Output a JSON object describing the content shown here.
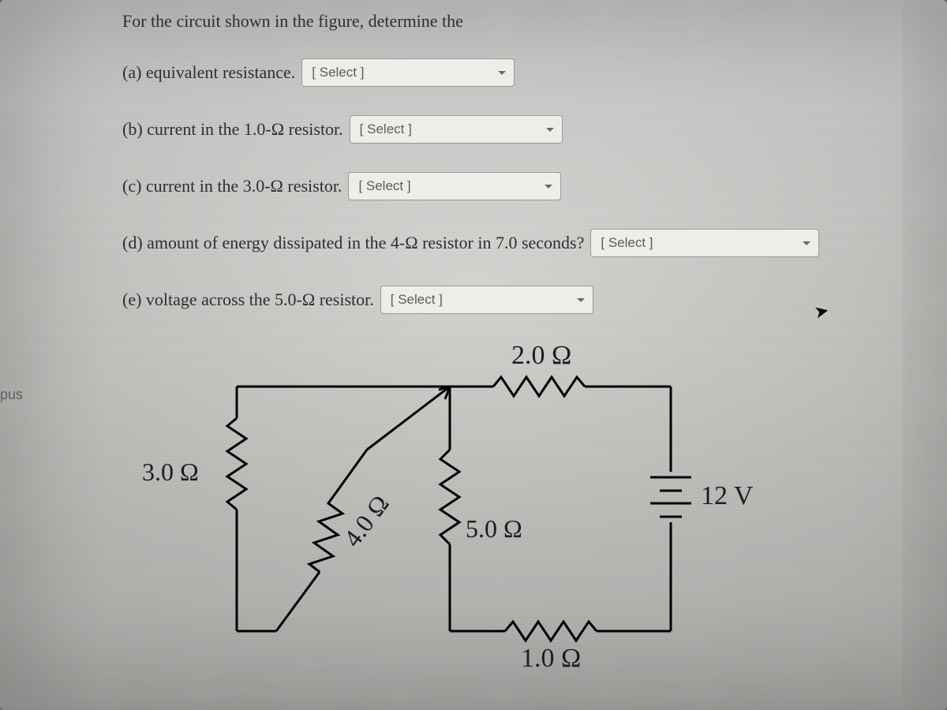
{
  "sidebar": {
    "tab_label": "pus"
  },
  "question": {
    "intro": "For the circuit shown in the figure, determine the",
    "parts": {
      "a": "(a) equivalent resistance.",
      "b": "(b) current in the 1.0-Ω resistor.",
      "c": "(c) current in the 3.0-Ω resistor.",
      "d": "(d) amount of energy dissipated in the 4-Ω resistor in 7.0 seconds?",
      "e": "(e) voltage across the 5.0-Ω resistor."
    },
    "select_placeholder": "[ Select ]"
  },
  "circuit": {
    "r_left": "3.0 Ω",
    "r_diag": "4.0 Ω",
    "r_mid": "5.0 Ω",
    "r_top": "2.0 Ω",
    "r_bottom": "1.0 Ω",
    "battery": "12 V"
  }
}
